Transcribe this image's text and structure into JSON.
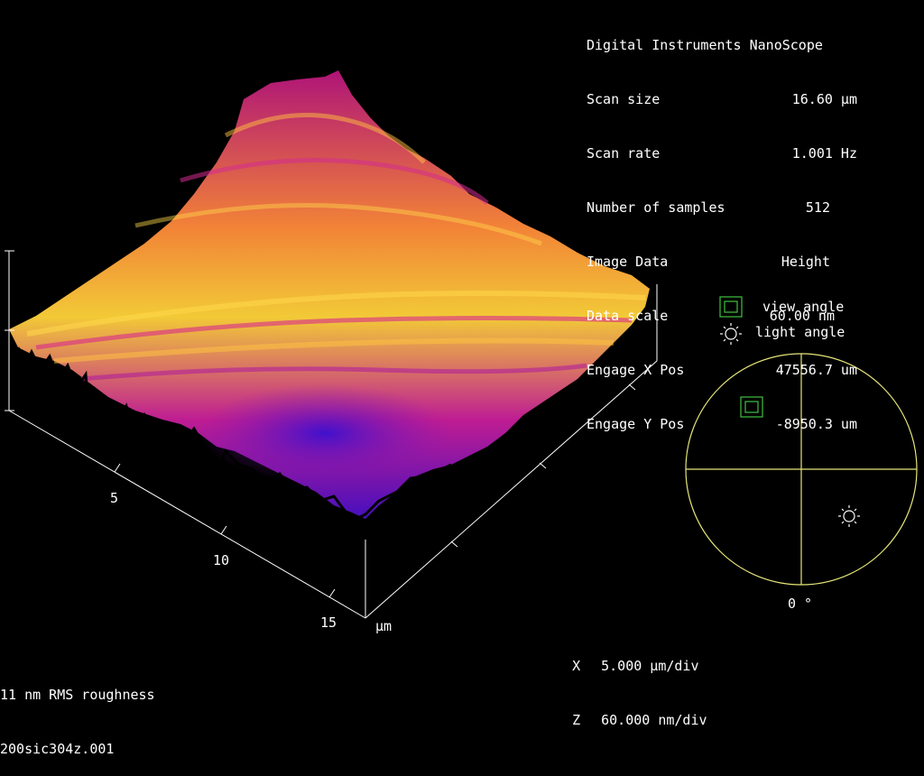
{
  "header": {
    "title": "Digital Instruments NanoScope",
    "rows": [
      {
        "key": "Scan size",
        "value": "16.60 µm"
      },
      {
        "key": "Scan rate",
        "value": "1.001 Hz"
      },
      {
        "key": "Number of samples",
        "value": "512"
      },
      {
        "key": "Image Data",
        "value": "Height"
      },
      {
        "key": "Data scale",
        "value": "60.00 nm"
      },
      {
        "key": "Engage X Pos",
        "value": "47556.7 um"
      },
      {
        "key": "Engage Y Pos",
        "value": "-8950.3 um"
      }
    ]
  },
  "axes": {
    "ticks": [
      "5",
      "10",
      "15"
    ],
    "unit": "µm"
  },
  "scale": {
    "x_label": "X",
    "x_value": "5.000 µm/div",
    "z_label": "Z",
    "z_value": "60.000 nm/div"
  },
  "angle_legend": {
    "view_label": "view angle",
    "light_label": "light angle",
    "zero_label": "0 °"
  },
  "footer": {
    "roughness": "11 nm RMS roughness",
    "filename": "200sic304z.001"
  },
  "colors": {
    "axis": "#ffffff",
    "circle": "#e6e67a",
    "view_box": "#3fc03f",
    "surface_high": "#ffd43a",
    "surface_mid": "#c81e9a",
    "surface_low": "#5a16c8"
  },
  "icons": {
    "view": "view-angle-square-icon",
    "light": "sun-icon"
  }
}
